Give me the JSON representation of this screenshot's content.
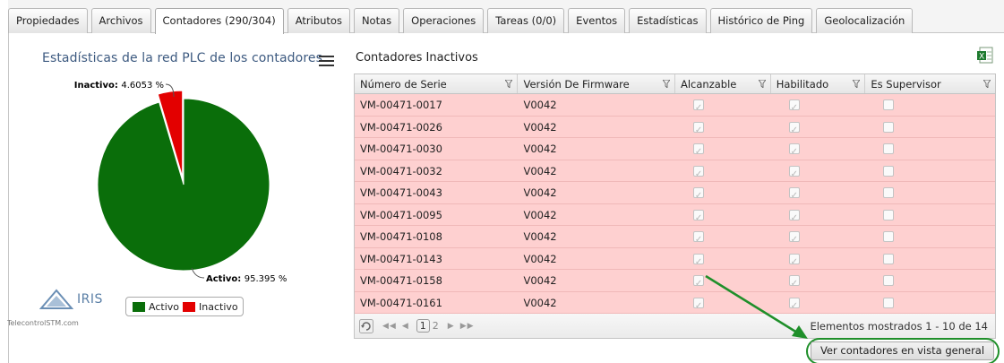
{
  "tabs": [
    {
      "label": "Propiedades",
      "active": false
    },
    {
      "label": "Archivos",
      "active": false
    },
    {
      "label": "Contadores (290/304)",
      "active": true
    },
    {
      "label": "Atributos",
      "active": false
    },
    {
      "label": "Notas",
      "active": false
    },
    {
      "label": "Operaciones",
      "active": false
    },
    {
      "label": "Tareas (0/0)",
      "active": false
    },
    {
      "label": "Eventos",
      "active": false
    },
    {
      "label": "Estadísticas",
      "active": false
    },
    {
      "label": "Histórico de Ping",
      "active": false
    },
    {
      "label": "Geolocalización",
      "active": false
    }
  ],
  "chart": {
    "title": "Estadísticas de la red PLC de los contadores",
    "menu_icon": "hamburger-menu-icon"
  },
  "chart_data": {
    "type": "pie",
    "title": "Estadísticas de la red PLC de los contadores",
    "slices": [
      {
        "name": "Activo",
        "value": 95.395,
        "color": "#0a6e0a",
        "label_name": "Activo",
        "label_value": "95.395 %"
      },
      {
        "name": "Inactivo",
        "value": 4.6053,
        "color": "#e30000",
        "label_name": "Inactivo",
        "label_value": "4.6053 %"
      }
    ],
    "legend_position": "bottom",
    "legend": [
      {
        "name": "Activo",
        "color": "#0a6e0a"
      },
      {
        "name": "Inactivo",
        "color": "#e30000"
      }
    ]
  },
  "logo": {
    "name": "IRIS",
    "subtitle": "TelecontrolSTM.com"
  },
  "grid": {
    "title": "Contadores Inactivos",
    "export_icon": "excel-export-icon",
    "columns": [
      "Número de Serie",
      "Versión De Firmware",
      "Alcanzable",
      "Habilitado",
      "Es Supervisor"
    ],
    "rows": [
      {
        "serial": "VM-00471-0017",
        "firmware": "V0042",
        "reachable": true,
        "enabled": true,
        "supervisor": false
      },
      {
        "serial": "VM-00471-0026",
        "firmware": "V0042",
        "reachable": true,
        "enabled": true,
        "supervisor": false
      },
      {
        "serial": "VM-00471-0030",
        "firmware": "V0042",
        "reachable": true,
        "enabled": true,
        "supervisor": false
      },
      {
        "serial": "VM-00471-0032",
        "firmware": "V0042",
        "reachable": true,
        "enabled": true,
        "supervisor": false
      },
      {
        "serial": "VM-00471-0043",
        "firmware": "V0042",
        "reachable": true,
        "enabled": true,
        "supervisor": false
      },
      {
        "serial": "VM-00471-0095",
        "firmware": "V0042",
        "reachable": true,
        "enabled": true,
        "supervisor": false
      },
      {
        "serial": "VM-00471-0108",
        "firmware": "V0042",
        "reachable": true,
        "enabled": true,
        "supervisor": false
      },
      {
        "serial": "VM-00471-0143",
        "firmware": "V0042",
        "reachable": true,
        "enabled": true,
        "supervisor": false
      },
      {
        "serial": "VM-00471-0158",
        "firmware": "V0042",
        "reachable": true,
        "enabled": true,
        "supervisor": false
      },
      {
        "serial": "VM-00471-0161",
        "firmware": "V0042",
        "reachable": true,
        "enabled": true,
        "supervisor": false
      }
    ],
    "pager": {
      "current_page": "1",
      "next_page": "2",
      "info": "Elementos mostrados 1 - 10 de 14"
    }
  },
  "view_all_button": "Ver contadores en vista general",
  "annotation_color": "#1f8f2a"
}
